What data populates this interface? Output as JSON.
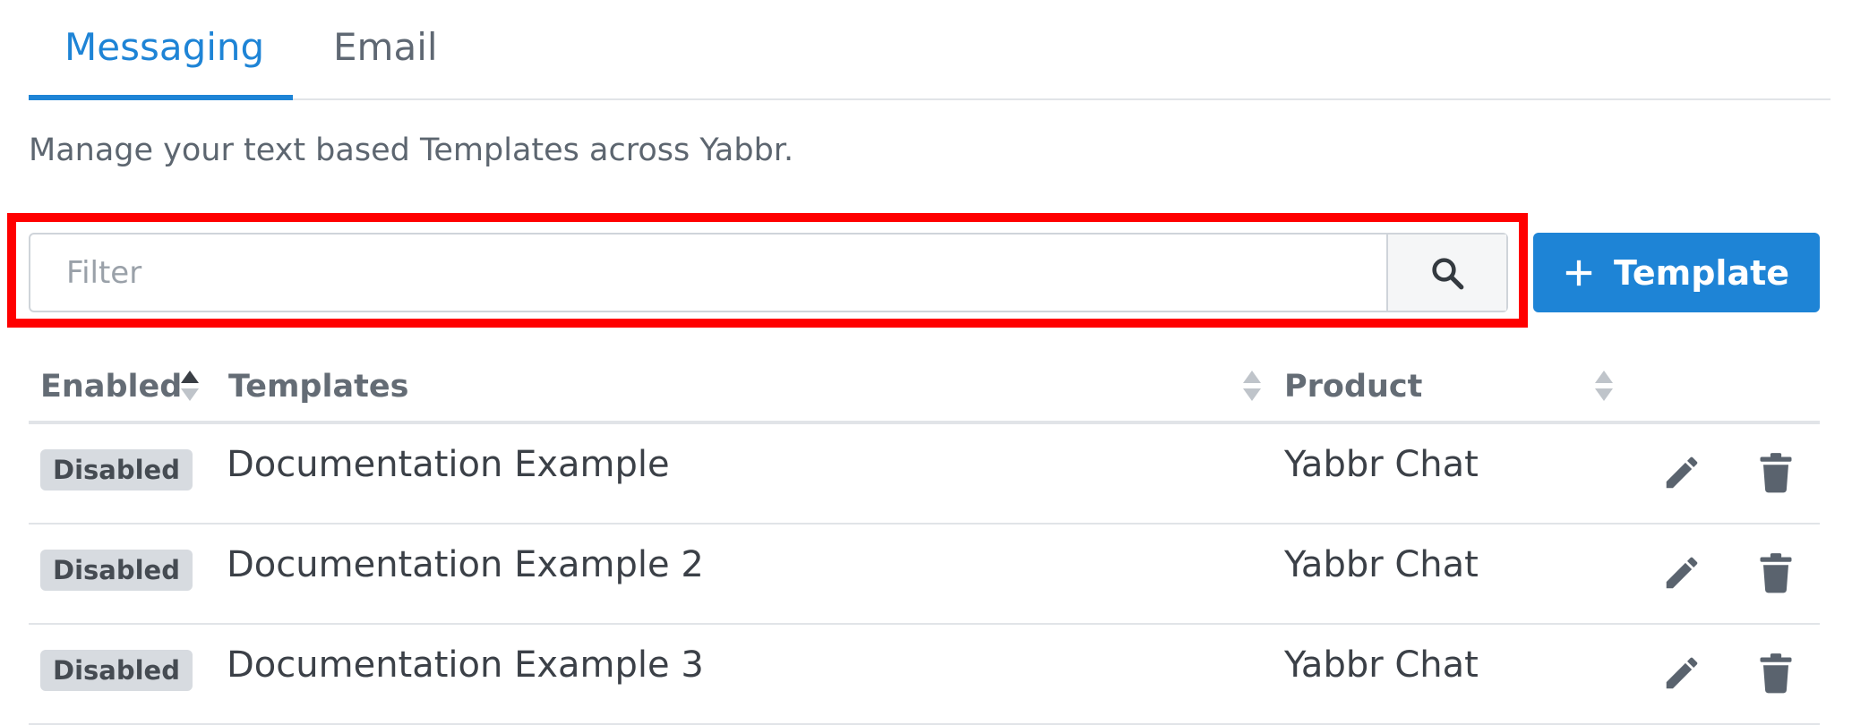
{
  "tabs": [
    {
      "label": "Messaging",
      "active": true
    },
    {
      "label": "Email",
      "active": false
    }
  ],
  "description": "Manage your text based Templates across Yabbr.",
  "filter": {
    "placeholder": "Filter",
    "value": ""
  },
  "add_button": {
    "label": "Template",
    "icon": "plus-icon"
  },
  "table": {
    "columns": [
      "Enabled",
      "Templates",
      "Product"
    ],
    "rows": [
      {
        "status": "Disabled",
        "template": "Documentation Example",
        "product": "Yabbr Chat"
      },
      {
        "status": "Disabled",
        "template": "Documentation Example 2",
        "product": "Yabbr Chat"
      },
      {
        "status": "Disabled",
        "template": "Documentation Example 3",
        "product": "Yabbr Chat"
      }
    ]
  },
  "colors": {
    "accent": "#1e84d6",
    "highlight": "#ff0000",
    "badge_bg": "#d7dbe0",
    "icon": "#5a636e"
  }
}
